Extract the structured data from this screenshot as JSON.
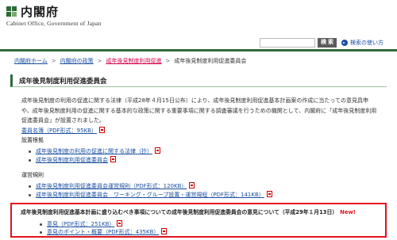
{
  "header": {
    "logo_title": "内閣府",
    "logo_subtitle": "Cabinet Office, Government of Japan",
    "search_placeholder": "",
    "search_button": "検 索",
    "help_link": "検索の使い方",
    "brand_color": "#2f6b3c"
  },
  "breadcrumb": {
    "items": [
      "内閣府ホーム",
      "内閣府の政策",
      "成年後見制度利用促進",
      "成年後見制度利用促進委員会"
    ]
  },
  "page": {
    "title": "成年後見制度利用促進委員会",
    "intro": "成年後見制度の利用の促進に関する法律（平成28年４月15日公布）により、成年後見制度利用促進基本計画案の作成に当たっての意見具申や、成年後見制度利用の促進に関する基本的な政策に関する重要事項に関する調査審議を行うための機関として、内閣府に「成年後見制度利用促進委員会」が設置されました。",
    "member_list_link": "委員名簿（PDF形式：95KB）",
    "setup_basis_label": "設置根拠",
    "setup_basis_items": [
      "成年後見制度の利用の促進に関する法律（抄）",
      "成年後見制度利用促進委員会"
    ],
    "operation_rules_label": "運営規則",
    "operation_rules_items": [
      "成年後見制度利用促進委員会運営規則（PDF形式：120KB）",
      "成年後見制度利用促進委員会　ワーキング・グループ設置・運営規程（PDF形式：141KB）"
    ]
  },
  "highlight": {
    "title": "成年後見制度利用促進基本計画に盛り込むべき事項についての成年後見制度利用促進委員会の意見について（平成29年１月13日）",
    "new_label": "New!",
    "items": [
      "意見（PDF形式：251KB）",
      "意見のポイント・概要（PDF形式：435KB）"
    ],
    "border_color": "#e2141b"
  }
}
